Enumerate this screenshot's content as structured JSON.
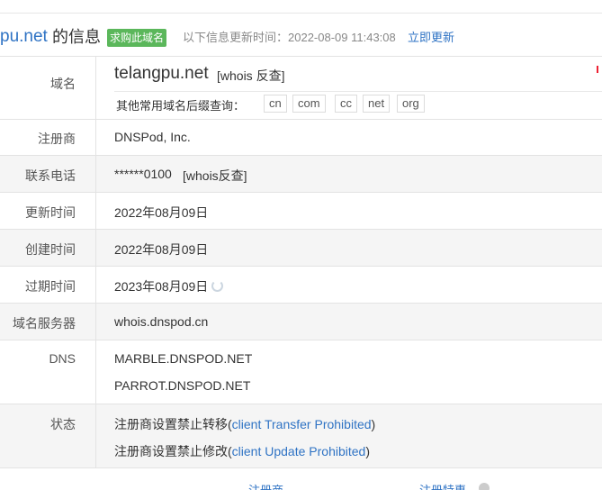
{
  "header": {
    "domain": "pu.net",
    "suffix": "的信息",
    "buy_button": "求购此域名",
    "update_info": "以下信息更新时间：2022-08-09 11:43:08",
    "update_link": "立即更新"
  },
  "rows": {
    "domain": {
      "label": "域名",
      "value": "telangpu.net",
      "whois_link": "[whois 反查]",
      "suffix_label": "其他常用域名后缀查询：",
      "suffixes": [
        "cn",
        "com",
        "cc",
        "net",
        "org"
      ]
    },
    "registrar": {
      "label": "注册商",
      "value": "DNSPod, Inc."
    },
    "phone": {
      "label": "联系电话",
      "value": "******0100",
      "whois_link": "[whois反查]"
    },
    "updated": {
      "label": "更新时间",
      "value": "2022年08月09日"
    },
    "created": {
      "label": "创建时间",
      "value": "2022年08月09日"
    },
    "expires": {
      "label": "过期时间",
      "value": "2023年08月09日",
      "icon": "refresh-icon"
    },
    "whois_server": {
      "label": "域名服务器",
      "value": "whois.dnspod.cn"
    },
    "dns": {
      "label": "DNS",
      "values": [
        "MARBLE.DNSPOD.NET",
        "PARROT.DNSPOD.NET"
      ]
    },
    "status": {
      "label": "状态",
      "items": [
        {
          "text": "注册商设置禁止转移(",
          "code": "client Transfer Prohibited",
          "close": ")"
        },
        {
          "text": "注册商设置禁止修改(",
          "code": "client Update Prohibited",
          "close": ")"
        }
      ]
    }
  },
  "footer": {
    "link1": "注册商",
    "link2": "注册特惠"
  },
  "colors": {
    "link": "#2f73c4",
    "buy_button": "#5bb75b",
    "row_gray": "#f5f5f5"
  }
}
